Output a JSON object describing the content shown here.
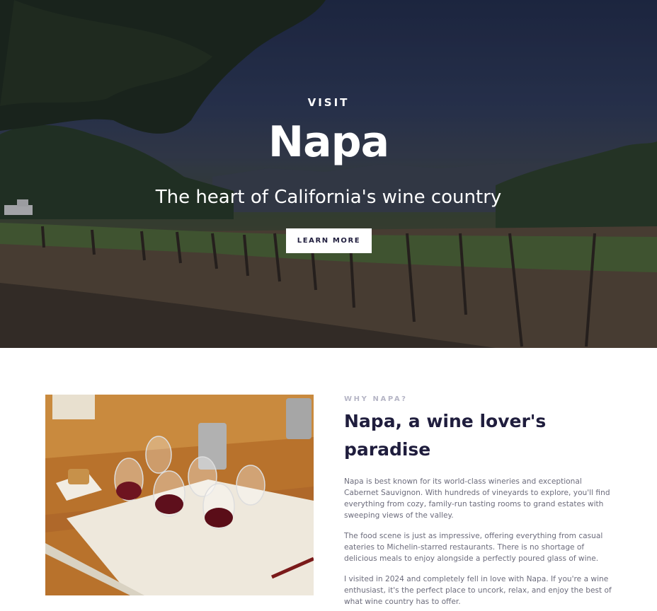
{
  "hero": {
    "eyebrow": "VISIT",
    "title": "Napa",
    "subtitle": "The heart of California's wine country",
    "button_label": "LEARN MORE"
  },
  "about": {
    "eyebrow": "WHY NAPA?",
    "title": "Napa, a wine lover's paradise",
    "paragraphs": [
      "Napa is best known for its world-class wineries and exceptional Cabernet Sauvignon. With hundreds of vineyards to explore, you'll find everything from cozy, family-run tasting rooms to grand estates with sweeping views of the valley.",
      "The food scene is just as impressive, offering everything from casual eateries to Michelin-starred restaurants. There is no shortage of delicious meals to enjoy alongside a perfectly poured glass of wine.",
      "I visited in 2024 and completely fell in love with Napa. If you're a wine enthusiast, it's the perfect place to uncork, relax, and enjoy the best of what wine country has to offer."
    ]
  },
  "colors": {
    "heading": "#1f1d3d",
    "eyebrow": "#b6b6c6",
    "body_text": "#6c6c7c",
    "button_bg": "#ffffff"
  }
}
